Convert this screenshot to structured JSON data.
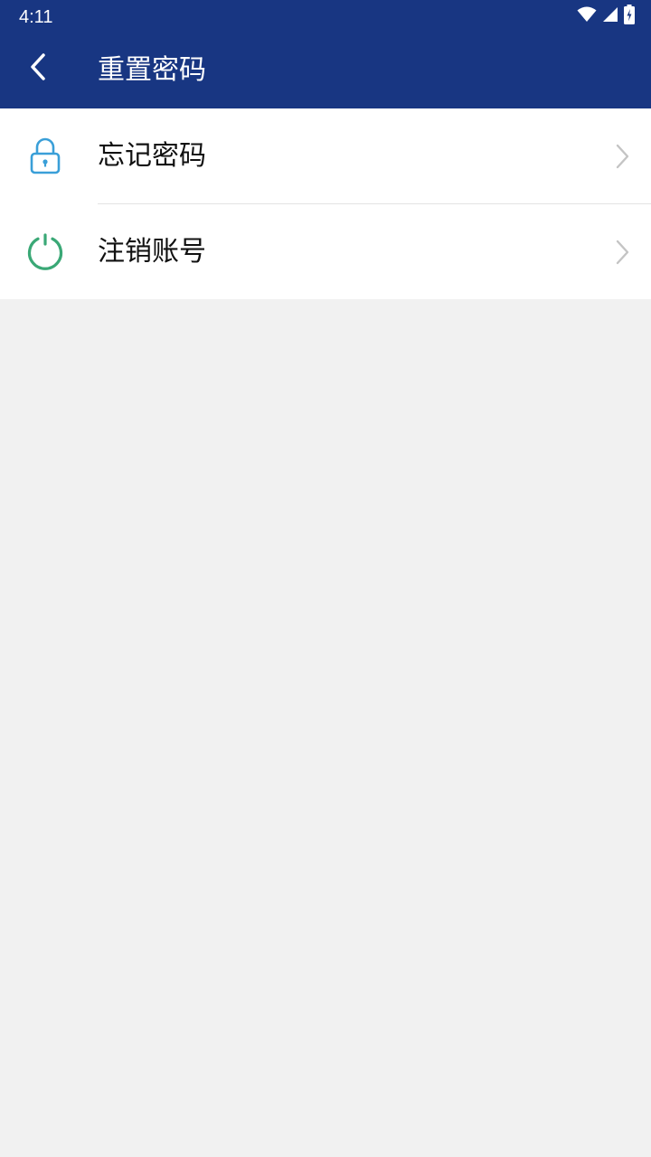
{
  "status_bar": {
    "time": "4:11",
    "icons": [
      "wifi-icon",
      "cell-signal-icon",
      "battery-charging-icon"
    ]
  },
  "header": {
    "title": "重置密码",
    "back_icon": "chevron-left-icon",
    "background_color": "#183682"
  },
  "menu": {
    "items": [
      {
        "label": "忘记密码",
        "icon": "lock-icon",
        "icon_color": "#3a9fd8",
        "trailing_icon": "chevron-right-icon"
      },
      {
        "label": "注销账号",
        "icon": "power-icon",
        "icon_color": "#3aa876",
        "trailing_icon": "chevron-right-icon"
      }
    ]
  },
  "colors": {
    "page_background": "#f1f1f1",
    "list_background": "#ffffff",
    "chevron": "#c4c4c4"
  }
}
